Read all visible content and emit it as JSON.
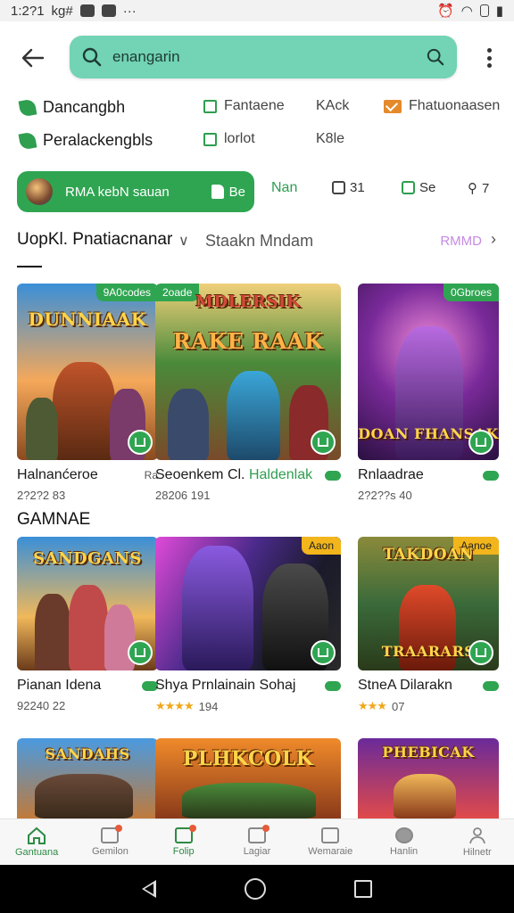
{
  "status_bar": {
    "time": "1:2?1",
    "carrier": "kg#",
    "battery": ""
  },
  "search": {
    "value": "enangarin"
  },
  "filters": {
    "row1": [
      {
        "label": "Dancangbh",
        "icon": "leaf-icon"
      },
      {
        "label": "Fantaene",
        "icon": "square-icon"
      },
      {
        "label": "KAck",
        "icon": ""
      },
      {
        "label": "Fhatuonaasen",
        "icon": "envelope-icon"
      }
    ],
    "row2": [
      {
        "label": "Peralackengbls",
        "icon": "leaf-icon"
      },
      {
        "label": "lorlot",
        "icon": "square-icon"
      },
      {
        "label": "K8le",
        "icon": ""
      }
    ]
  },
  "chips": {
    "main_label": "RMA kebN sauan",
    "main_count": "Be",
    "items": [
      {
        "label": "Nan"
      },
      {
        "label": "31"
      },
      {
        "label": "Se"
      },
      {
        "label": "7"
      }
    ]
  },
  "section1": {
    "title": "UopKl. Pnatiacnanar",
    "subtitle": "Staakn Mndam",
    "see_all": "RMMD"
  },
  "section2": {
    "title": "GAMNAE"
  },
  "cards_row1": [
    {
      "badge": "9A0codes",
      "art_title": "DUNNIAAK",
      "name": "Halnanćeroe",
      "pill_text": "Ra",
      "meta": "2?2?2 83"
    },
    {
      "badge": "2oade",
      "art_title": "RAKE RAAK",
      "art_title2": "MDLERSIK",
      "name_prefix": "Seoenkem Cl. ",
      "name_highlight": "Haldenlak",
      "meta": "28206 191"
    },
    {
      "badge": "0Gbroes",
      "art_title": "DOAN FHANSAK",
      "name": "Rnlaadrae",
      "meta": "2?2??s 40"
    }
  ],
  "cards_row2": [
    {
      "art_title": "SANDGANS",
      "name": "Pianan Idena",
      "meta": "92240 22"
    },
    {
      "badge": "Aaon",
      "name": "Shya Prnlainain Sohaj",
      "stars": "★★★★",
      "meta": "194"
    },
    {
      "badge": "Aanoe",
      "art_title": "TAKDOAN",
      "art_title2": "TRAARARS",
      "name": "StneA Dilarakn",
      "stars": "★★★",
      "meta": "07"
    }
  ],
  "cards_row3": [
    {
      "art_title": "SANDAHS"
    },
    {
      "art_title": "PLHKCOLK"
    },
    {
      "art_title": "PHEBICAK"
    }
  ],
  "bottom_nav": [
    {
      "label": "Gantuana",
      "active": true
    },
    {
      "label": "Gemilon",
      "active": false
    },
    {
      "label": "Folip",
      "active": false
    },
    {
      "label": "Lagiar",
      "active": false
    },
    {
      "label": "Wemaraie",
      "active": false
    },
    {
      "label": "Hanlin",
      "active": false
    },
    {
      "label": "Hilnetr",
      "active": false
    }
  ],
  "colors": {
    "accent": "#2fa551",
    "search_bg": "#72d3b5",
    "see_all": "#c68be3"
  }
}
